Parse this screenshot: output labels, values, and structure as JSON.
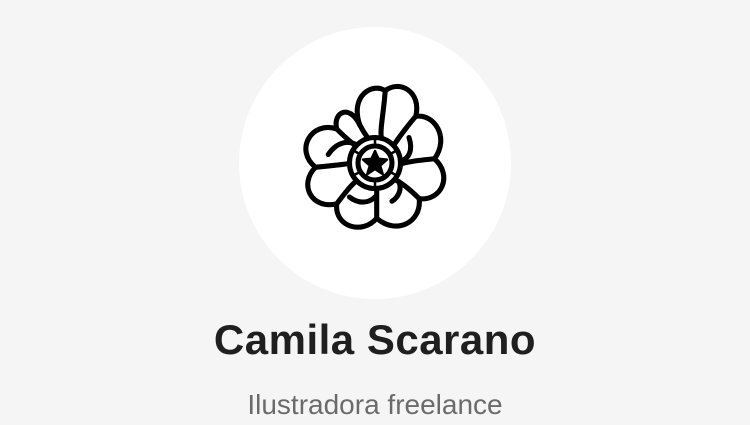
{
  "profile": {
    "avatar_icon": "flower-icon",
    "name": "Camila Scarano",
    "role": "Ilustradora freelance"
  },
  "colors": {
    "background": "#f5f5f5",
    "avatar_background": "#ffffff",
    "name_text": "#1f1f1f",
    "role_text": "#6b6b6b",
    "icon_stroke": "#000000"
  }
}
